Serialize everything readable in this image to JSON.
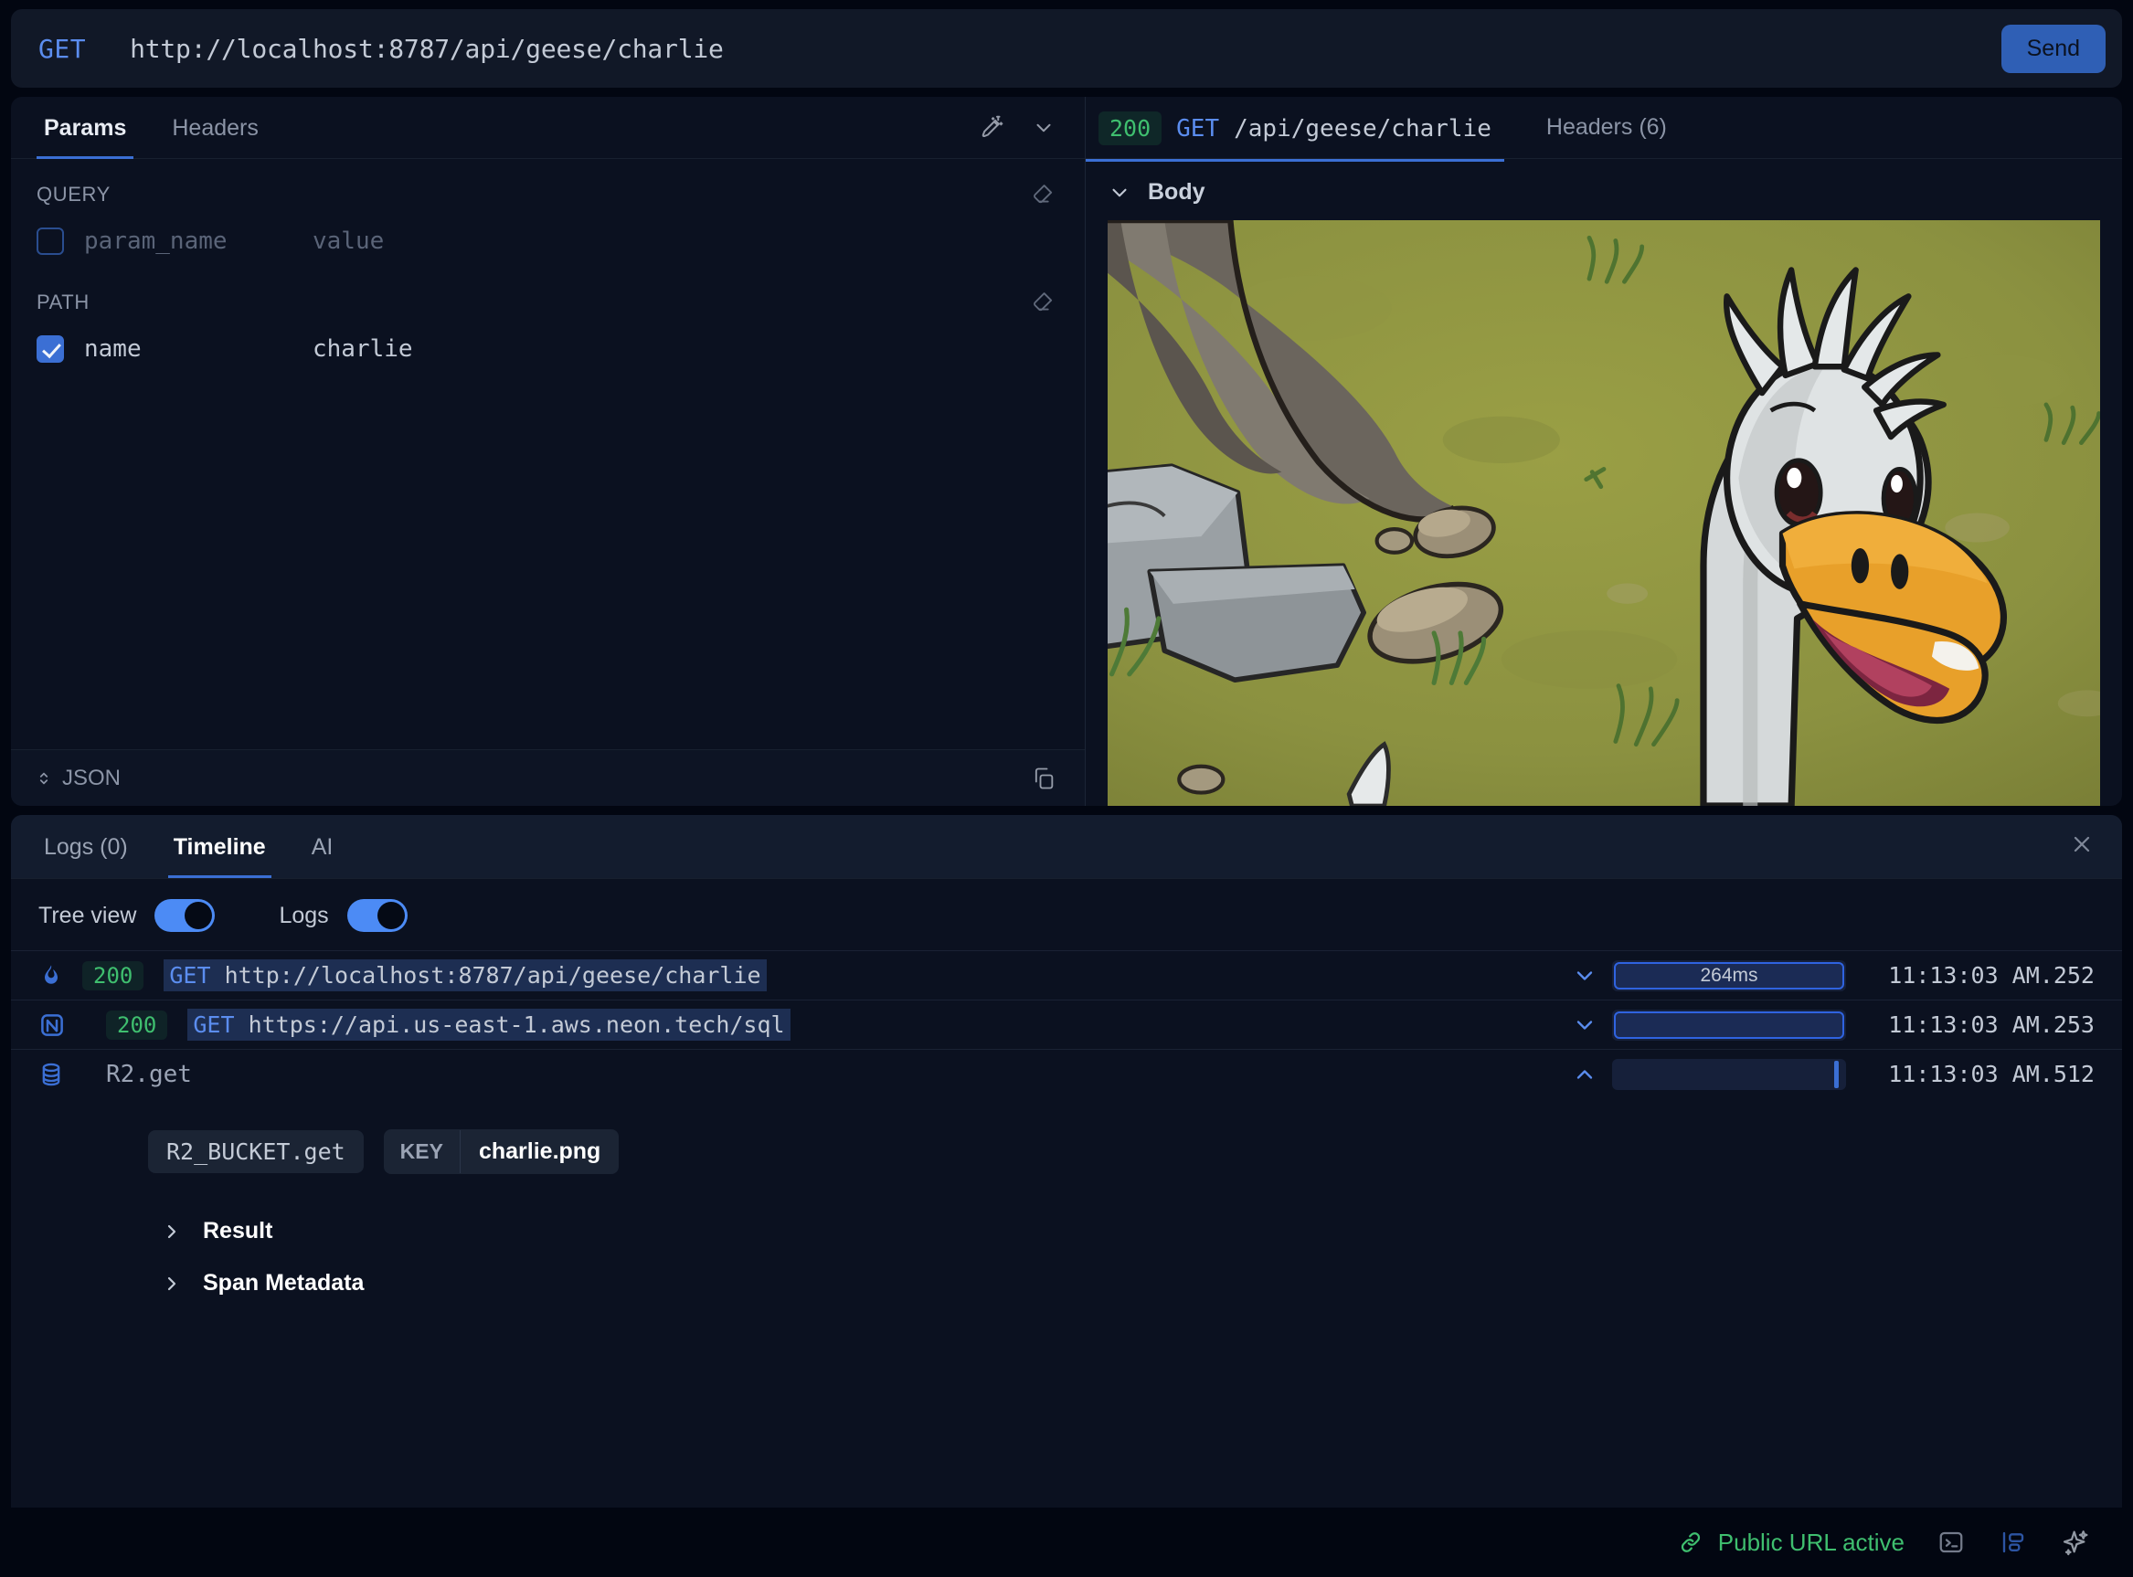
{
  "urlbar": {
    "method": "GET",
    "url": "http://localhost:8787/api/geese/charlie",
    "send_label": "Send"
  },
  "request_panel": {
    "tabs": [
      {
        "label": "Params",
        "active": true
      },
      {
        "label": "Headers",
        "active": false
      }
    ],
    "magic_icon": "magic-wand-icon",
    "chevron_icon": "chevron-down-icon",
    "query": {
      "label": "QUERY",
      "clear_icon": "eraser-icon",
      "rows": [
        {
          "checked": false,
          "name": "param_name",
          "value": "value"
        }
      ]
    },
    "path": {
      "label": "PATH",
      "clear_icon": "eraser-icon",
      "rows": [
        {
          "checked": true,
          "name": "name",
          "value": "charlie"
        }
      ]
    },
    "footer": {
      "body_type": "JSON",
      "copy_icon": "copy-icon"
    }
  },
  "response_panel": {
    "status": "200",
    "method": "GET",
    "path": "/api/geese/charlie",
    "headers_tab": "Headers (6)",
    "body_label": "Body",
    "body_chevron": "chevron-down-icon",
    "body_media": "goose-photo"
  },
  "bottom_panel": {
    "tabs": [
      {
        "label": "Logs (0)",
        "active": false
      },
      {
        "label": "Timeline",
        "active": true
      },
      {
        "label": "AI",
        "active": false
      }
    ],
    "close_icon": "close-icon",
    "controls": [
      {
        "label": "Tree view",
        "on": true
      },
      {
        "label": "Logs",
        "on": true
      }
    ],
    "timeline": [
      {
        "icon": "flame-icon",
        "status": "200",
        "method": "GET",
        "url": "http://localhost:8787/api/geese/charlie",
        "duration": "264ms",
        "bar_start_pct": 0,
        "bar_width_pct": 100,
        "timestamp": "11:13:03 AM.252",
        "chevron": "chevron-down-icon",
        "expanded": false
      },
      {
        "icon": "neon-icon",
        "status": "200",
        "method": "GET",
        "url": "https://api.us-east-1.aws.neon.tech/sql",
        "duration": "",
        "bar_start_pct": 0,
        "bar_width_pct": 100,
        "timestamp": "11:13:03 AM.253",
        "chevron": "chevron-down-icon",
        "expanded": false
      },
      {
        "icon": "database-icon",
        "status": "",
        "method": "",
        "url": "",
        "name": "R2.get",
        "duration": "",
        "bar_start_pct": 96,
        "bar_width_pct": 2,
        "timestamp": "11:13:03 AM.512",
        "chevron": "chevron-up-icon",
        "expanded": true
      }
    ],
    "span_detail": {
      "operation_chip": "R2_BUCKET.get",
      "key_label": "KEY",
      "key_value": "charlie.png",
      "sections": [
        {
          "label": "Result",
          "icon": "chevron-right-icon",
          "expanded": false
        },
        {
          "label": "Span Metadata",
          "icon": "chevron-right-icon",
          "expanded": false
        }
      ]
    }
  },
  "statusbar": {
    "public_url_label": "Public URL active",
    "link_icon": "link-icon",
    "icons": [
      "terminal-icon",
      "layout-panel-icon",
      "sparkles-icon"
    ]
  },
  "colors": {
    "accent": "#3b6fd4",
    "success": "#3fbf6f",
    "bg": "#020611",
    "panel": "#0b1120"
  }
}
